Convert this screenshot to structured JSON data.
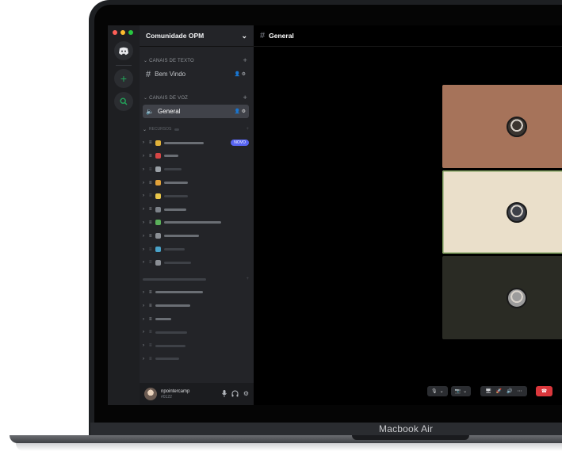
{
  "device": {
    "label": "Macbook Air"
  },
  "rail": {
    "colors": [
      "#ff5f57",
      "#febc2e",
      "#28c840"
    ],
    "home_icon": "discord-icon",
    "add_icon": "plus-icon",
    "explore_icon": "compass-icon"
  },
  "server": {
    "name": "Comunidade OPM",
    "chevron": "⌄"
  },
  "categories": {
    "text": {
      "label": "CANAIS DE TEXTO",
      "add": "+"
    },
    "voice": {
      "label": "CANAIS DE VOZ",
      "add": "+"
    }
  },
  "channels": {
    "welcome": {
      "label": "Bem Vindo",
      "icon": "#"
    },
    "general": {
      "label": "General",
      "icon": "🔈"
    }
  },
  "recursos": {
    "label": "RECURSOS"
  },
  "rows": [
    {
      "emoji": "🔑",
      "color": "#e2b23a",
      "w": 50,
      "badge": "NOVO",
      "dim": false
    },
    {
      "emoji": "📕",
      "color": "#d64545",
      "w": 18,
      "badge": "",
      "dim": false
    },
    {
      "emoji": "🏢",
      "color": "#9aa0a6",
      "w": 22,
      "badge": "",
      "dim": true
    },
    {
      "emoji": "🎨",
      "color": "#e2a23a",
      "w": 30,
      "badge": "",
      "dim": false
    },
    {
      "emoji": "🙂",
      "color": "#e8c64a",
      "w": 30,
      "badge": "",
      "dim": true
    },
    {
      "emoji": "📁",
      "color": "#7c8289",
      "w": 28,
      "badge": "",
      "dim": false
    },
    {
      "emoji": "📗",
      "color": "#5bb05b",
      "w": 72,
      "badge": "",
      "dim": false
    },
    {
      "emoji": "🎬",
      "color": "#8b8f95",
      "w": 44,
      "badge": "",
      "dim": false
    },
    {
      "emoji": "💬",
      "color": "#4aa3c9",
      "w": 26,
      "badge": "",
      "dim": true
    },
    {
      "emoji": "📘",
      "color": "#8b8f95",
      "w": 34,
      "badge": "",
      "dim": true
    }
  ],
  "rows2": [
    {
      "w": 60,
      "dim": false
    },
    {
      "w": 44,
      "dim": false
    },
    {
      "w": 20,
      "dim": false
    },
    {
      "w": 40,
      "dim": true
    },
    {
      "w": 38,
      "dim": true
    },
    {
      "w": 30,
      "dim": true
    }
  ],
  "user": {
    "name": "npointercamp",
    "status": "#0122"
  },
  "main": {
    "channel_hash": "#",
    "channel_name": "General"
  },
  "tiles": [
    {
      "bg": "#a6735a",
      "face": "#3b3530",
      "outline": "none"
    },
    {
      "bg": "#1c1f26",
      "face": "#6b6458",
      "outline": "none"
    },
    {
      "bg": "#eadfca",
      "face": "#3d4048",
      "outline": "#7b9c5a"
    },
    {
      "bg": "#1c1f26",
      "face": "#a8a49c",
      "outline": "none"
    },
    {
      "bg": "#2a2b24",
      "face": "#9c9c9c",
      "outline": "none"
    },
    {
      "bg": "#1c1f26",
      "face": "#e2c3a5",
      "outline": "none"
    }
  ],
  "controls": {
    "hangup": "☎"
  }
}
